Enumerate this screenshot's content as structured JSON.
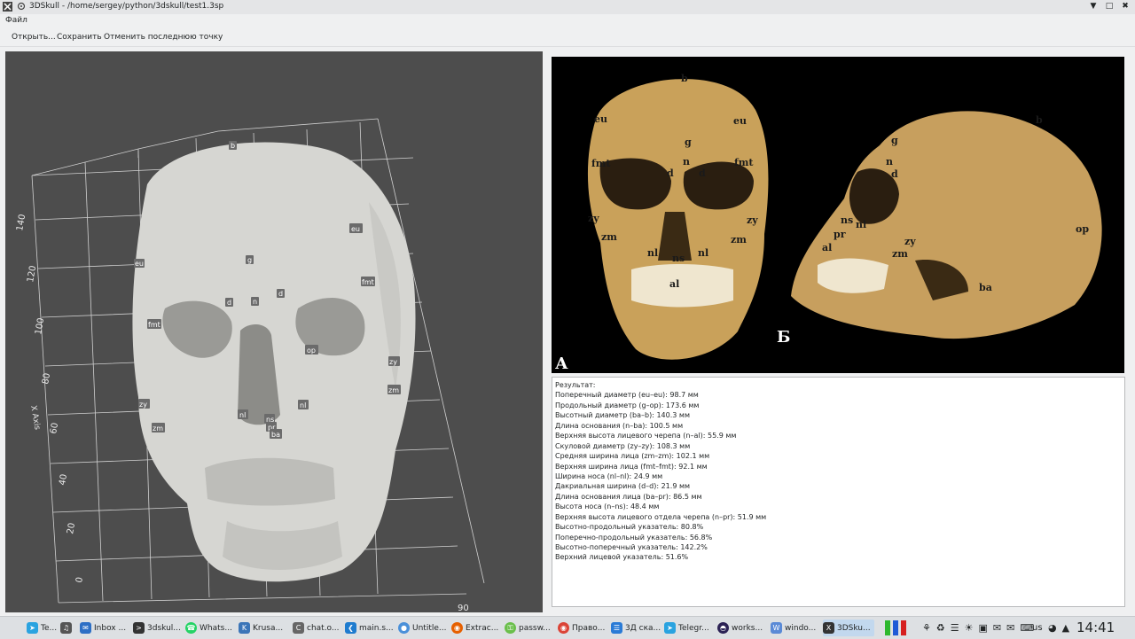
{
  "window": {
    "title": "3DSkull - /home/sergey/python/3dskull/test1.3sp",
    "icons": [
      "app-icon",
      "pin-icon",
      "minimize-icon",
      "maximize-icon",
      "close-icon"
    ]
  },
  "menu": {
    "file": "Файл"
  },
  "toolbar": {
    "open": "Открыть...",
    "save": "Сохранить",
    "undo": "Отменить последнюю точку"
  },
  "viewer": {
    "axis_label": "X Axis",
    "ticks": [
      "140",
      "120",
      "100",
      "80",
      "60",
      "40",
      "20",
      "0"
    ],
    "bottom_tick": "90",
    "landmarks": [
      "b",
      "eu",
      "eu",
      "g",
      "fmt",
      "fmt",
      "d",
      "n",
      "d",
      "op",
      "zy",
      "zy",
      "zm",
      "zm",
      "nl",
      "ns",
      "nl",
      "pr",
      "ba"
    ]
  },
  "photo": {
    "label_a": "А",
    "label_b": "Б",
    "front_landmarks": [
      "b",
      "eu",
      "eu",
      "g",
      "n",
      "fmt",
      "fmt",
      "d",
      "d",
      "zy",
      "zy",
      "zm",
      "zm",
      "nl",
      "ns",
      "nl",
      "al"
    ],
    "side_landmarks": [
      "b",
      "g",
      "n",
      "d",
      "ns",
      "nl",
      "pr",
      "al",
      "zy",
      "zm",
      "op",
      "ba"
    ]
  },
  "results": {
    "heading": "Результат:",
    "lines": [
      "Поперечный диаметр (eu–eu): 98.7 мм",
      "Продольный диаметр (g–op): 173.6 мм",
      "Высотный диаметр (ba–b): 140.3 мм",
      "Длина основания (n–ba): 100.5 мм",
      "Верхняя высота лицевого черепа (n–al): 55.9 мм",
      "Скуловой диаметр (zy–zy): 108.3 мм",
      "Средняя ширина лица (zm–zm): 102.1 мм",
      "Верхняя ширина лица (fmt–fmt): 92.1 мм",
      "Ширина носа (nl–nl): 24.9 мм",
      "Дакриальная ширина (d–d): 21.9 мм",
      "Длина основания лица (ba–pr): 86.5 мм",
      "Высота носа (n–ns): 48.4 мм",
      "Верхняя высота лицевого отдела черепа (n–pr): 51.9 мм",
      "Высотно-продольный указатель: 80.8%",
      "Поперечно-продольный указатель: 56.8%",
      "Высотно-поперечный указатель: 142.2%",
      "Верхний лицевой указатель: 51.6%"
    ]
  },
  "taskbar": {
    "tasks": [
      {
        "label": "Te...",
        "icon": "telegram-icon",
        "color": "#2aa3e0"
      },
      {
        "label": "",
        "icon": "volume-icon",
        "color": "#555555"
      },
      {
        "label": "Inbox ...",
        "icon": "thunderbird-icon",
        "color": "#2d6fc5"
      },
      {
        "label": "3dskul...",
        "icon": "terminal-icon",
        "color": "#333333"
      },
      {
        "label": "Whats...",
        "icon": "whatsapp-icon",
        "color": "#25d366"
      },
      {
        "label": "Krusa...",
        "icon": "krusader-icon",
        "color": "#3b75b8"
      },
      {
        "label": "chat.o...",
        "icon": "chat-icon",
        "color": "#666666"
      },
      {
        "label": "main.s...",
        "icon": "vscode-icon",
        "color": "#1f7ccf"
      },
      {
        "label": "Untitle...",
        "icon": "untitled-icon",
        "color": "#4a90d9"
      },
      {
        "label": "Extrac...",
        "icon": "firefox-icon",
        "color": "#e66000"
      },
      {
        "label": "passw...",
        "icon": "keepass-icon",
        "color": "#6abf4b"
      },
      {
        "label": "Право...",
        "icon": "chrome-icon",
        "color": "#db4437"
      },
      {
        "label": "3Д ска...",
        "icon": "document-icon",
        "color": "#2a7bd6"
      },
      {
        "label": "Telegr...",
        "icon": "telegram-icon",
        "color": "#2aa3e0"
      },
      {
        "label": "works...",
        "icon": "eclipse-icon",
        "color": "#2c2255"
      },
      {
        "label": "windo...",
        "icon": "window-icon",
        "color": "#5a8ad6"
      },
      {
        "label": "3DSku...",
        "icon": "app-icon",
        "color": "#333333"
      }
    ],
    "lang": "us",
    "clock": "14:41"
  }
}
